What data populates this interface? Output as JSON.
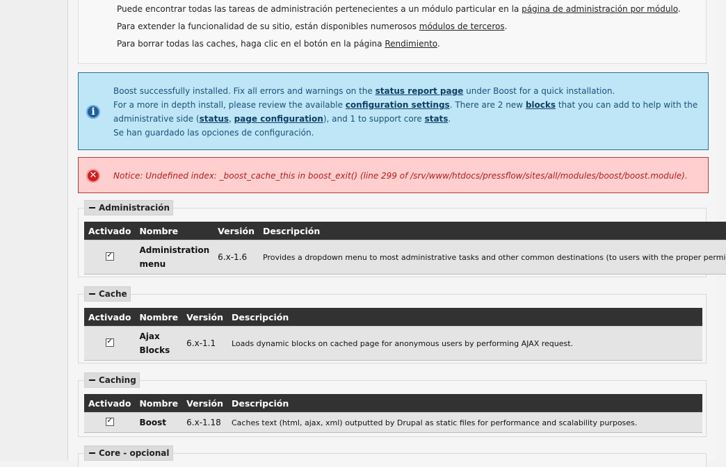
{
  "help": {
    "line1_pre": "Puede encontrar todas las tareas de administración pertenecientes a un módulo particular en la ",
    "line1_link": "página de administración por módulo",
    "line1_post": ".",
    "line2_pre": "Para extender la funcionalidad de su sitio, están disponibles numerosos ",
    "line2_link": "módulos de terceros",
    "line2_post": ".",
    "line3_pre": "Para borrar todas las caches, haga clic en el botón en la página ",
    "line3_link": "Rendimiento",
    "line3_post": "."
  },
  "status_message": {
    "l1_pre": "Boost successfully installed. Fix all errors and warnings on the ",
    "l1_link": "status report page",
    "l1_post": " under Boost for a quick installation.",
    "l2_pre": "For a more in depth install, please review the available ",
    "l2_link1": "configuration settings",
    "l2_mid": ". There are 2 new ",
    "l2_link2": "blocks",
    "l2_post": " that you can add to help with the",
    "l3_pre": "administrative side (",
    "l3_link1": "status",
    "l3_sep": ", ",
    "l3_link2": "page configuration",
    "l3_mid": "), and 1 to support core ",
    "l3_link3": "stats",
    "l3_post": ".",
    "l4": "Se han guardado las opciones de configuración."
  },
  "error_message": {
    "notice": "Notice: Undefined index: _boost_cache_this in boost_exit() (line 299 of /srv/www/htdocs/pressflow/sites/all/modules/boost/boost.module)."
  },
  "columns": {
    "enabled": "Activado",
    "name": "Nombre",
    "version": "Versión",
    "description": "Descripción"
  },
  "groups": [
    {
      "legend": "Administración",
      "module": {
        "enabled": true,
        "checkmark": "✓",
        "name": "Administration menu",
        "version": "6.x-1.6",
        "description": "Provides a dropdown menu to most administrative tasks and other common destinations (to users with the proper permissions)."
      }
    },
    {
      "legend": "Cache",
      "module": {
        "enabled": true,
        "checkmark": "✓",
        "name": "Ajax Blocks",
        "version": "6.x-1.1",
        "description": "Loads dynamic blocks on cached page for anonymous users by performing AJAX request."
      }
    },
    {
      "legend": "Caching",
      "module": {
        "enabled": true,
        "checkmark": "✓",
        "name": "Boost",
        "version": "6.x-1.18",
        "description": "Caches text (html, ajax, xml) outputted by Drupal as static files for performance and scalability purposes."
      }
    },
    {
      "legend": "Core - opcional"
    }
  ],
  "icons": {
    "info": "i",
    "error": "✕"
  },
  "colors": {
    "status_bg": "#bfe6f7",
    "status_border": "#2c6e94",
    "error_bg": "#ffcfcf",
    "error_text": "#b21c1c",
    "table_header": "#323232"
  }
}
